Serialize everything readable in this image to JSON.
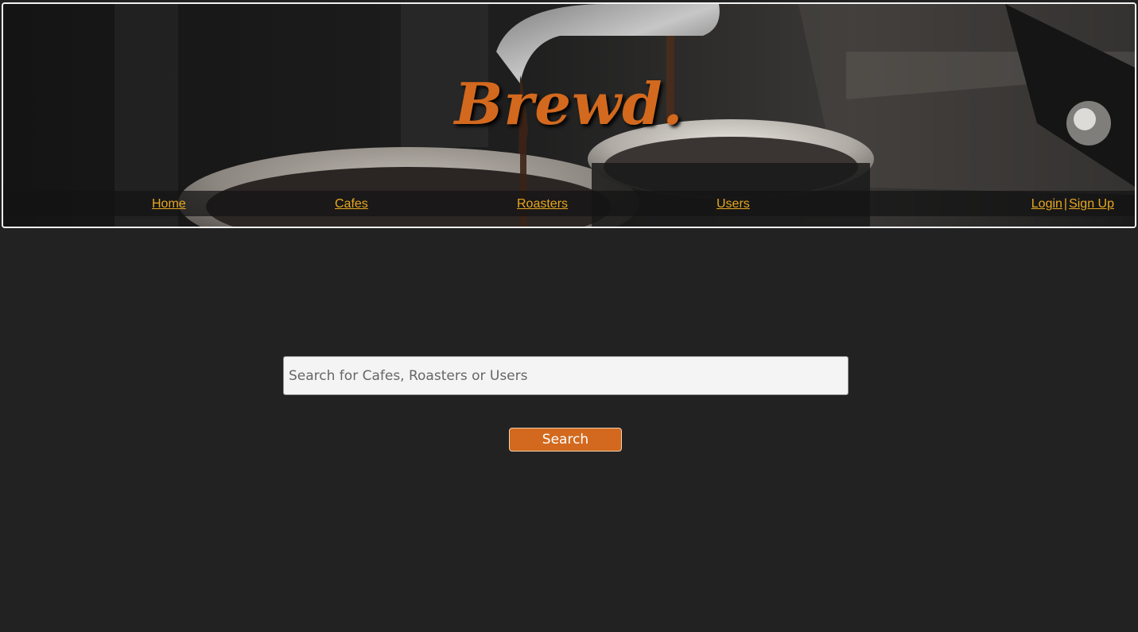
{
  "brand": {
    "logo_text": "Brewd."
  },
  "nav": {
    "home": "Home",
    "cafes": "Cafes",
    "roasters": "Roasters",
    "users": "Users",
    "login": "Login",
    "separator": "|",
    "signup": "Sign Up"
  },
  "search": {
    "placeholder": "Search for Cafes, Roasters or Users",
    "value": "",
    "button_label": "Search"
  },
  "colors": {
    "background": "#222222",
    "brand_orange": "#d2691e",
    "link_gold": "#e8a820",
    "input_bg": "#f4f4f4"
  },
  "icons": {
    "hero_image": "espresso-machine-pouring-coffee-photo"
  }
}
